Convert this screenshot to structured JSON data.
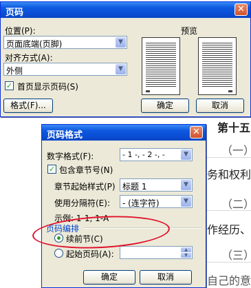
{
  "doc": {
    "lines": [
      "第十五",
      "（一）",
      "务和权利",
      "（二）",
      "作经历、",
      "（三）",
      "自己的意"
    ]
  },
  "dlg1": {
    "title": "页码",
    "position_label": "位置(P):",
    "position_value": "页面底端(页脚)",
    "align_label": "对齐方式(A):",
    "align_value": "外侧",
    "first_page_label": "首页显示页码(S)",
    "first_page_checked": true,
    "preview_label": "预览",
    "format_button": "格式(F)...",
    "ok_button": "确定",
    "cancel_button": "取消"
  },
  "dlg2": {
    "title": "页码格式",
    "number_format_label": "数字格式(F):",
    "number_format_value": "- 1 -, - 2 -, -",
    "include_chapter_label": "包含章节号(N)",
    "include_chapter_checked": true,
    "chapter_style_label": "章节起始样式(P)",
    "chapter_style_value": "标题 1",
    "separator_label": "使用分隔符(E):",
    "separator_value": "-  (连字符)",
    "example_text": "示例: 1-1, 1-A",
    "numbering_group": "页码编排",
    "continue_label": "续前节(C)",
    "continue_selected": true,
    "start_at_label": "起始页码(A):",
    "start_at_value": "",
    "ok_button": "确定",
    "cancel_button": "取消"
  },
  "colors": {
    "titlebar": "#0a4fd6",
    "dialog_bg": "#ece9d8",
    "group_label": "#0046d5",
    "annotation": "#e0102a"
  }
}
